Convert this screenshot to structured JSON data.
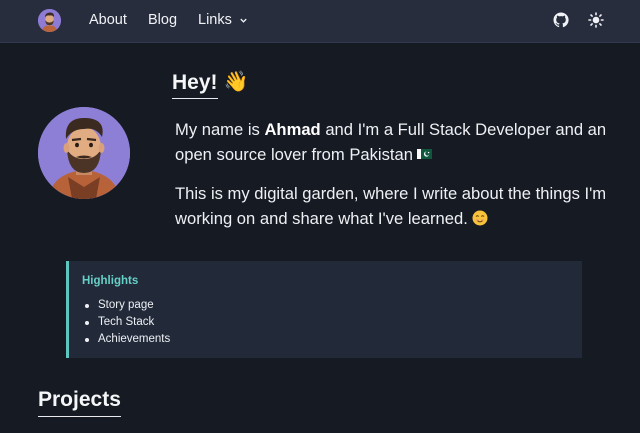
{
  "nav": {
    "about": "About",
    "blog": "Blog",
    "links": "Links",
    "github_icon": "github-icon",
    "theme_icon": "sun-icon"
  },
  "hero": {
    "greeting": "Hey!",
    "wave_emoji": "👋",
    "intro_prefix": "My name is ",
    "name": "Ahmad",
    "intro_suffix": " and I'm a Full Stack Developer and an open source lover from Pakistan",
    "flag_icon": "pakistan-flag-icon",
    "garden_text": "This is my digital garden, where I write about the things I'm working on and share what I've learned.",
    "smile_icon": "smiling-face-icon"
  },
  "highlights": {
    "title": "Highlights",
    "items": [
      "Story page",
      "Tech Stack",
      "Achievements"
    ]
  },
  "projects": {
    "title": "Projects"
  },
  "colors": {
    "background": "#161a23",
    "navbar": "#272d3d",
    "accent": "#5ec6bf",
    "card": "#222a3a"
  }
}
